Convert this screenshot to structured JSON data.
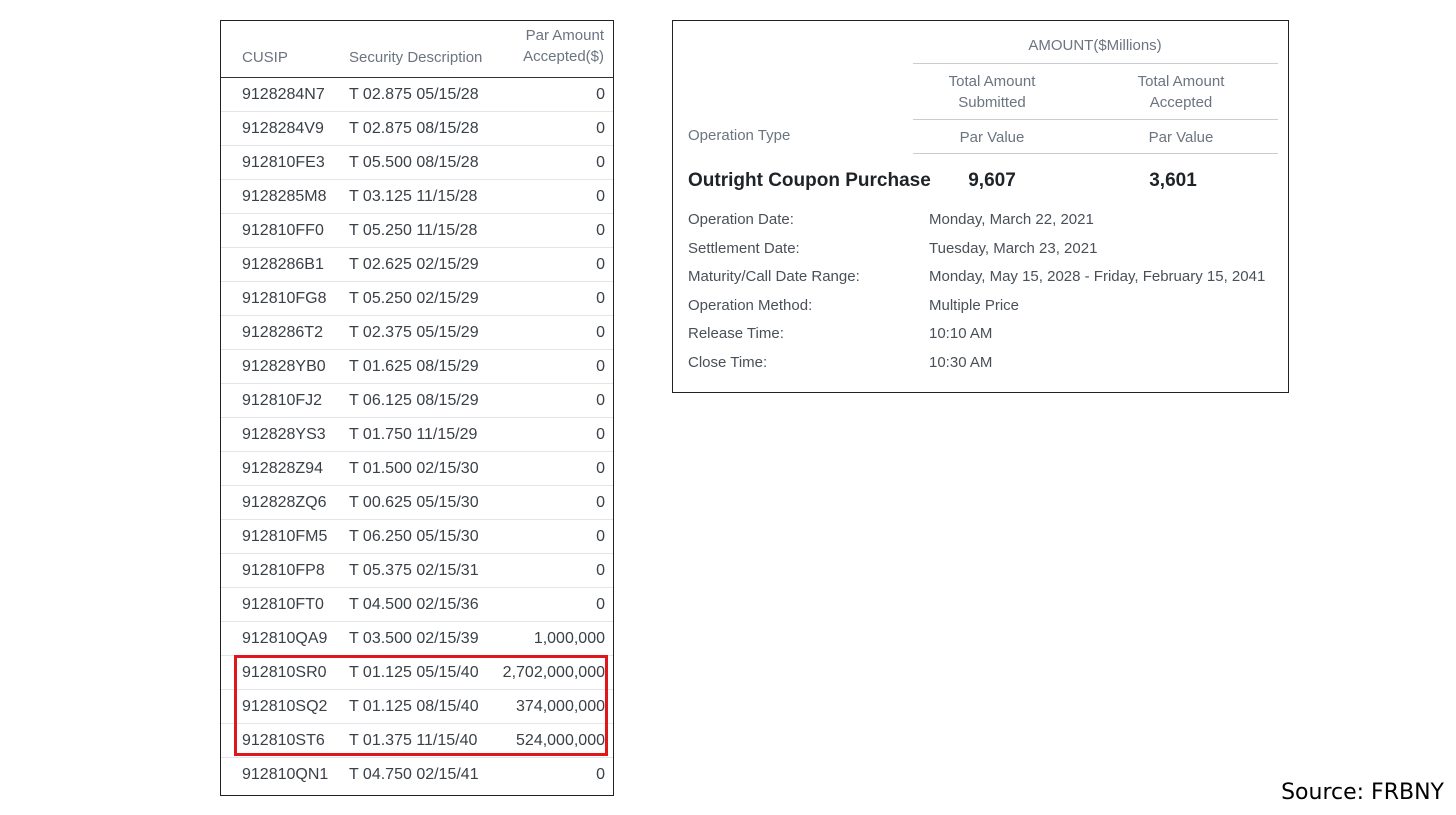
{
  "securities_table": {
    "headers": {
      "cusip": "CUSIP",
      "description": "Security Description",
      "par_line1": "Par Amount",
      "par_line2": "Accepted($)"
    },
    "rows": [
      {
        "cusip": "9128284N7",
        "description": "T 02.875 05/15/28",
        "par": "0"
      },
      {
        "cusip": "9128284V9",
        "description": "T 02.875 08/15/28",
        "par": "0"
      },
      {
        "cusip": "912810FE3",
        "description": "T 05.500 08/15/28",
        "par": "0"
      },
      {
        "cusip": "9128285M8",
        "description": "T 03.125 11/15/28",
        "par": "0"
      },
      {
        "cusip": "912810FF0",
        "description": "T 05.250 11/15/28",
        "par": "0"
      },
      {
        "cusip": "9128286B1",
        "description": "T 02.625 02/15/29",
        "par": "0"
      },
      {
        "cusip": "912810FG8",
        "description": "T 05.250 02/15/29",
        "par": "0"
      },
      {
        "cusip": "9128286T2",
        "description": "T 02.375 05/15/29",
        "par": "0"
      },
      {
        "cusip": "912828YB0",
        "description": "T 01.625 08/15/29",
        "par": "0"
      },
      {
        "cusip": "912810FJ2",
        "description": "T 06.125 08/15/29",
        "par": "0"
      },
      {
        "cusip": "912828YS3",
        "description": "T 01.750 11/15/29",
        "par": "0"
      },
      {
        "cusip": "912828Z94",
        "description": "T 01.500 02/15/30",
        "par": "0"
      },
      {
        "cusip": "912828ZQ6",
        "description": "T 00.625 05/15/30",
        "par": "0"
      },
      {
        "cusip": "912810FM5",
        "description": "T 06.250 05/15/30",
        "par": "0"
      },
      {
        "cusip": "912810FP8",
        "description": "T 05.375 02/15/31",
        "par": "0"
      },
      {
        "cusip": "912810FT0",
        "description": "T 04.500 02/15/36",
        "par": "0"
      },
      {
        "cusip": "912810QA9",
        "description": "T 03.500 02/15/39",
        "par": "1,000,000"
      },
      {
        "cusip": "912810SR0",
        "description": "T 01.125 05/15/40",
        "par": "2,702,000,000"
      },
      {
        "cusip": "912810SQ2",
        "description": "T 01.125 08/15/40",
        "par": "374,000,000"
      },
      {
        "cusip": "912810ST6",
        "description": "T 01.375 11/15/40",
        "par": "524,000,000"
      },
      {
        "cusip": "912810QN1",
        "description": "T 04.750 02/15/41",
        "par": "0"
      }
    ],
    "highlight_color": "#e0161b"
  },
  "operation": {
    "amount_header": "AMOUNT($Millions)",
    "col1_line1": "Total Amount",
    "col1_line2": "Submitted",
    "col2_line1": "Total Amount",
    "col2_line2": "Accepted",
    "par_value_1": "Par Value",
    "par_value_2": "Par Value",
    "operation_type_label": "Operation Type",
    "operation_type": "Outright Coupon Purchase",
    "total_submitted": "9,607",
    "total_accepted": "3,601",
    "details": [
      {
        "label": "Operation Date:",
        "value": "Monday, March 22, 2021"
      },
      {
        "label": "Settlement Date:",
        "value": "Tuesday, March 23, 2021"
      },
      {
        "label": "Maturity/Call Date Range:",
        "value": "Monday, May 15, 2028 - Friday, February 15, 2041"
      },
      {
        "label": "Operation Method:",
        "value": "Multiple Price"
      },
      {
        "label": "Release Time:",
        "value": "10:10 AM"
      },
      {
        "label": "Close Time:",
        "value": "10:30 AM"
      }
    ]
  },
  "source": "Source: FRBNY"
}
